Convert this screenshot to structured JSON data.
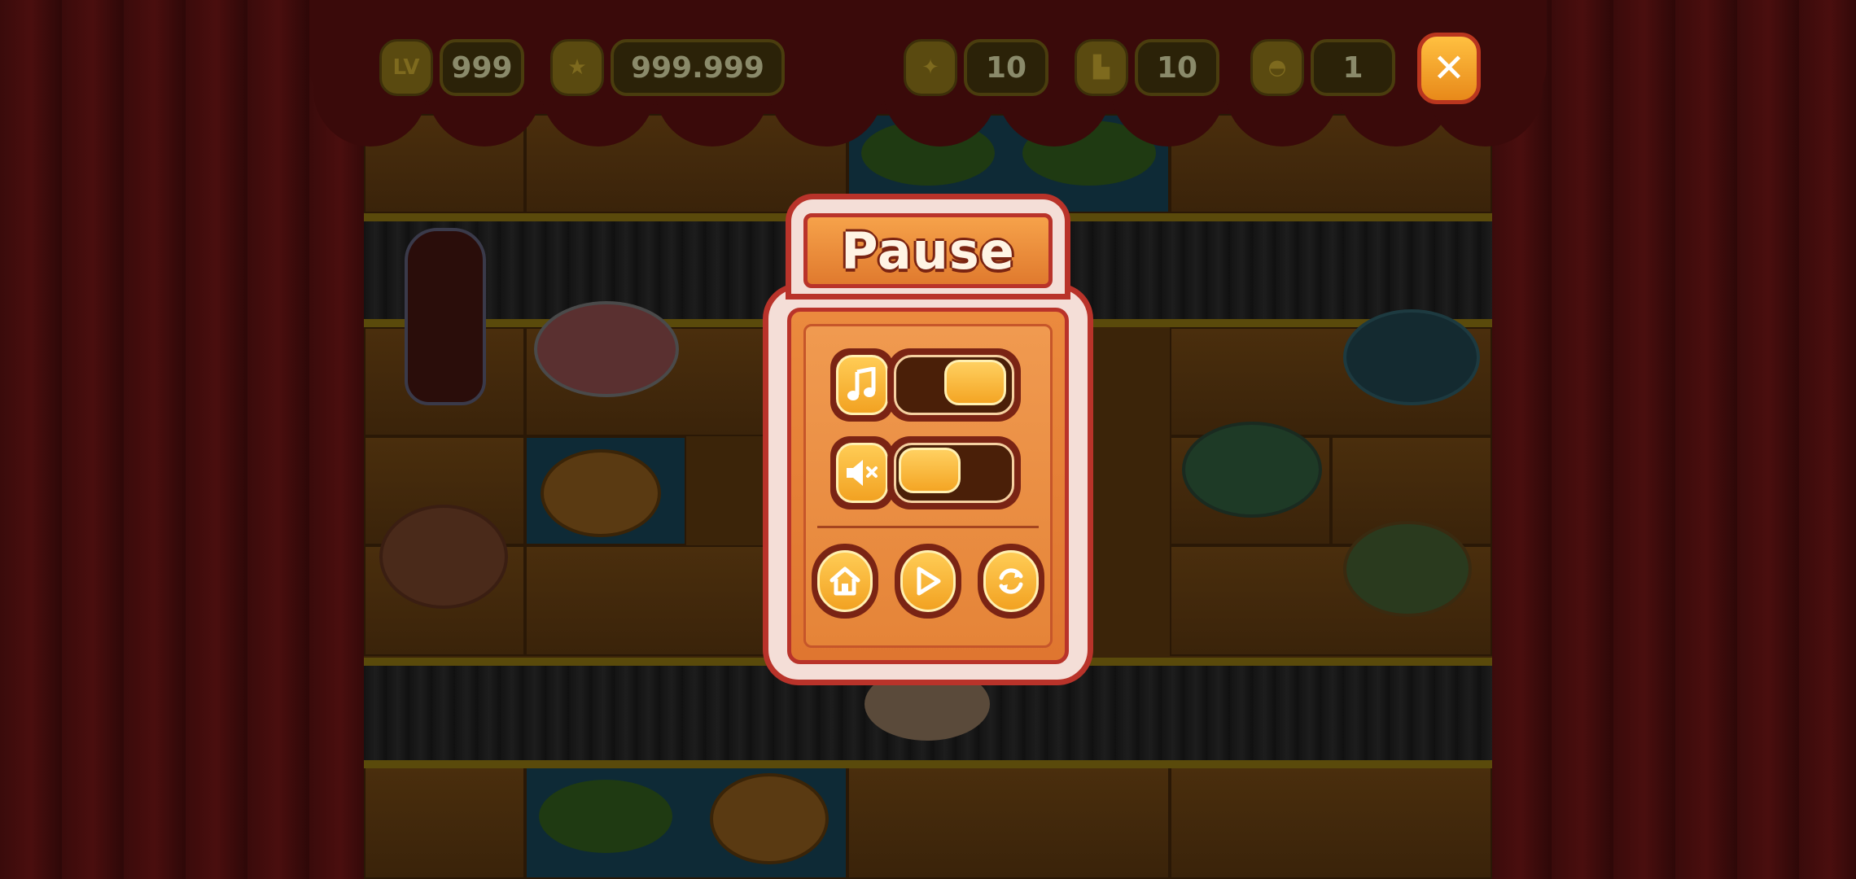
{
  "hud": {
    "level_icon_text": "LV",
    "level_value": "999",
    "star_icon": "star-icon",
    "score_value": "999.999",
    "sparkle_icon": "sparkle-icon",
    "sparkle_value": "10",
    "boot_icon": "boot-icon",
    "boot_value": "10",
    "bun_icon": "bun-icon",
    "bun_value": "1",
    "close_icon": "close-icon"
  },
  "pause_dialog": {
    "title": "Pause",
    "music_toggle": {
      "icon": "music-note-icon",
      "on": true
    },
    "sound_toggle": {
      "icon": "speaker-muted-icon",
      "on": false
    },
    "buttons": [
      {
        "icon": "home-icon"
      },
      {
        "icon": "play-icon"
      },
      {
        "icon": "restart-icon"
      }
    ]
  },
  "colors": {
    "accent_orange": "#f2a222",
    "frame_red": "#b9332a",
    "panel_cream": "#f4ded7"
  }
}
